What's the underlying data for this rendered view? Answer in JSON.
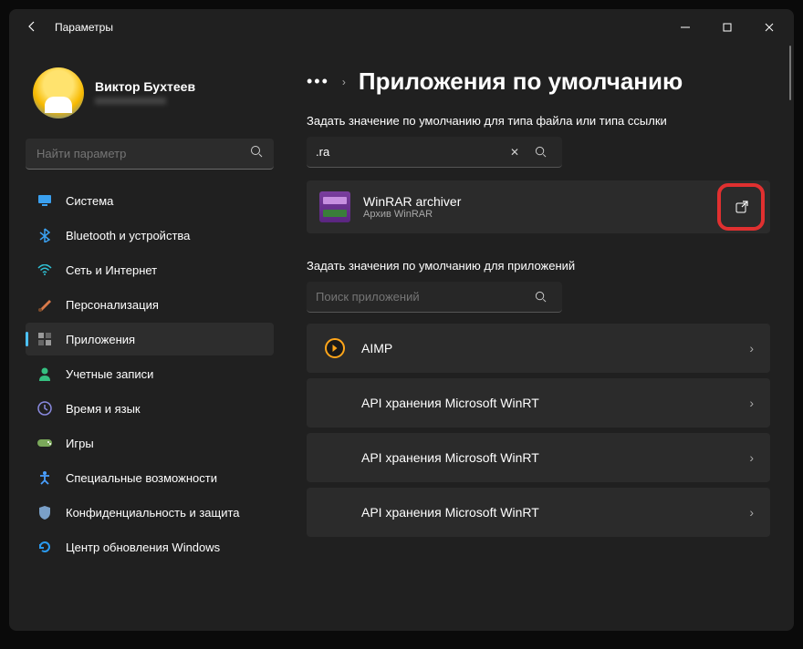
{
  "window": {
    "title": "Параметры"
  },
  "profile": {
    "name": "Виктор Бухтеев",
    "email": "xxxxxxxxxxxxx"
  },
  "sidebar": {
    "search_placeholder": "Найти параметр",
    "items": [
      {
        "label": "Система",
        "icon": "monitor",
        "color": "#3aa0f0"
      },
      {
        "label": "Bluetooth и устройства",
        "icon": "bluetooth",
        "color": "#3aa0f0"
      },
      {
        "label": "Сеть и Интернет",
        "icon": "wifi",
        "color": "#2fc2d6"
      },
      {
        "label": "Персонализация",
        "icon": "brush",
        "color": "#d97a4a"
      },
      {
        "label": "Приложения",
        "icon": "apps",
        "color": "#888",
        "active": true
      },
      {
        "label": "Учетные записи",
        "icon": "person",
        "color": "#35c080"
      },
      {
        "label": "Время и язык",
        "icon": "clock",
        "color": "#8a8ae0"
      },
      {
        "label": "Игры",
        "icon": "gamepad",
        "color": "#7aa85a"
      },
      {
        "label": "Специальные возможности",
        "icon": "accessibility",
        "color": "#4aa0ff"
      },
      {
        "label": "Конфиденциальность и защита",
        "icon": "shield",
        "color": "#7aa0c8"
      },
      {
        "label": "Центр обновления Windows",
        "icon": "update",
        "color": "#2a9af0"
      }
    ]
  },
  "main": {
    "page_title": "Приложения по умолчанию",
    "section1_label": "Задать значение по умолчанию для типа файла или типа ссылки",
    "filetype_input": ".ra",
    "result": {
      "name": "WinRAR archiver",
      "subtitle": "Архив WinRAR"
    },
    "section2_label": "Задать значения по умолчанию для приложений",
    "app_search_placeholder": "Поиск приложений",
    "apps": [
      {
        "name": "AIMP",
        "icon": "aimp"
      },
      {
        "name": "API хранения Microsoft WinRT",
        "icon": "none"
      },
      {
        "name": "API хранения Microsoft WinRT",
        "icon": "none"
      },
      {
        "name": "API хранения Microsoft WinRT",
        "icon": "none"
      }
    ]
  }
}
